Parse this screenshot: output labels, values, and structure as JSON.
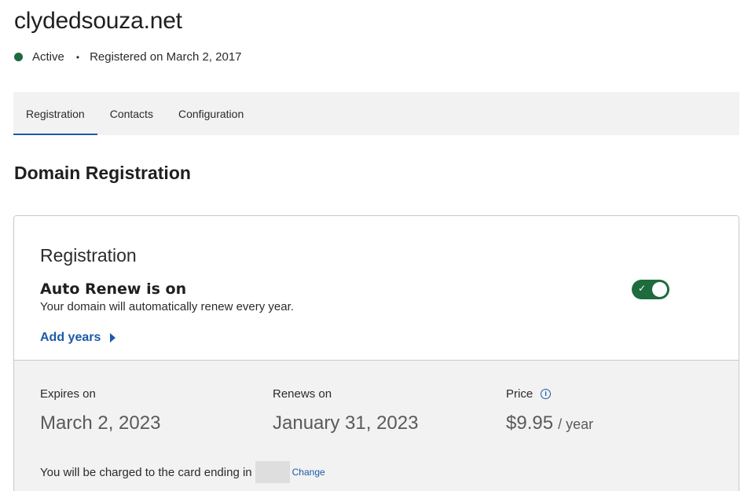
{
  "domain": {
    "name": "clydedsouza.net",
    "status": "Active",
    "registered": "Registered on March 2, 2017",
    "separator": "•",
    "status_color": "#1e6b3e"
  },
  "tabs": [
    {
      "label": "Registration",
      "active": true
    },
    {
      "label": "Contacts",
      "active": false
    },
    {
      "label": "Configuration",
      "active": false
    }
  ],
  "section_title": "Domain Registration",
  "card": {
    "heading": "Registration",
    "auto_renew": {
      "title": "Auto Renew is on",
      "description": "Your domain will automatically renew every year.",
      "enabled": true,
      "check_glyph": "✓"
    },
    "add_years_label": "Add years",
    "expires": {
      "label": "Expires on",
      "value": "March 2, 2023"
    },
    "renews": {
      "label": "Renews on",
      "value": "January 31, 2023"
    },
    "price": {
      "label": "Price",
      "value": "$9.95",
      "unit": "/ year",
      "info_icon": "i"
    },
    "charge_text": "You will be charged to the card ending in",
    "change_label": "Change"
  },
  "colors": {
    "accent_blue": "#1c5aa8",
    "toggle_green": "#1e6b3e",
    "panel_gray": "#f2f2f2"
  }
}
